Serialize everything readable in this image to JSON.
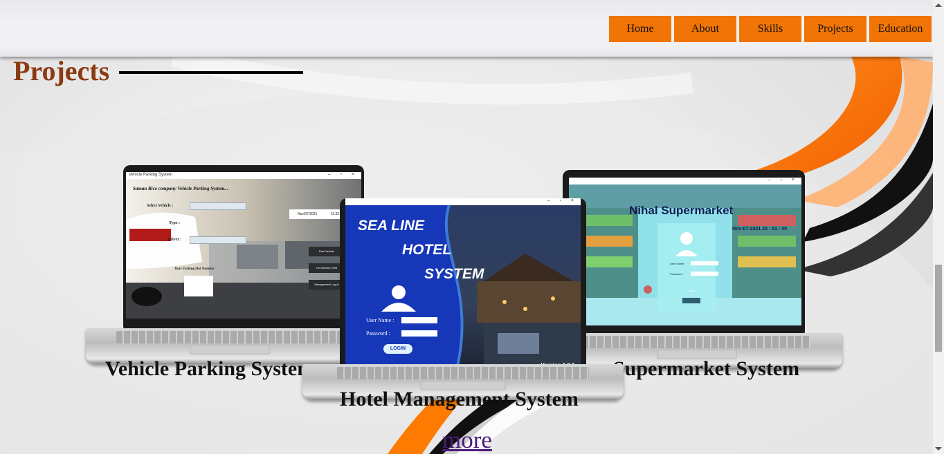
{
  "nav": {
    "items": [
      {
        "label": "Home"
      },
      {
        "label": "About"
      },
      {
        "label": "Skills"
      },
      {
        "label": "Projects"
      },
      {
        "label": "Education"
      }
    ]
  },
  "section": {
    "title": "Projects"
  },
  "projects": [
    {
      "caption": "Vehicle Parking System",
      "screen": {
        "window_title": "Vehicle Parking System",
        "heading": "Saman Rice company Vehicle Parking System...",
        "select_vehicle": "Select Vehicle :",
        "type": "Type :",
        "driver": "Driver :",
        "date": "Nov/07/2021",
        "time": "11:33",
        "btn_park": "Park Vehicle",
        "btn_delivery": "On Delivery Shift",
        "btn_management": "Management Log in",
        "slot_label": "Your Parking Slot Number"
      }
    },
    {
      "caption": "Hotel Management System",
      "screen": {
        "line1": "SEA LINE",
        "line2": "HOTEL",
        "line3": "SYSTEM",
        "username": "User Name :",
        "password": "Password  :",
        "login": "LOGIN",
        "version": "Version 1.0.0"
      }
    },
    {
      "caption": "Supermarket System",
      "screen": {
        "heading": "Nihal Supermarket",
        "datetime": "Nov-07-2021    23 : 51 : 40",
        "username": "User Name :",
        "password": "Password :",
        "login": "Login"
      }
    }
  ],
  "more_link": "more",
  "colors": {
    "nav_bg": "#f07406",
    "title": "#8b3b12",
    "link": "#4b1b7b",
    "accent_orange": "#ff6d00"
  }
}
